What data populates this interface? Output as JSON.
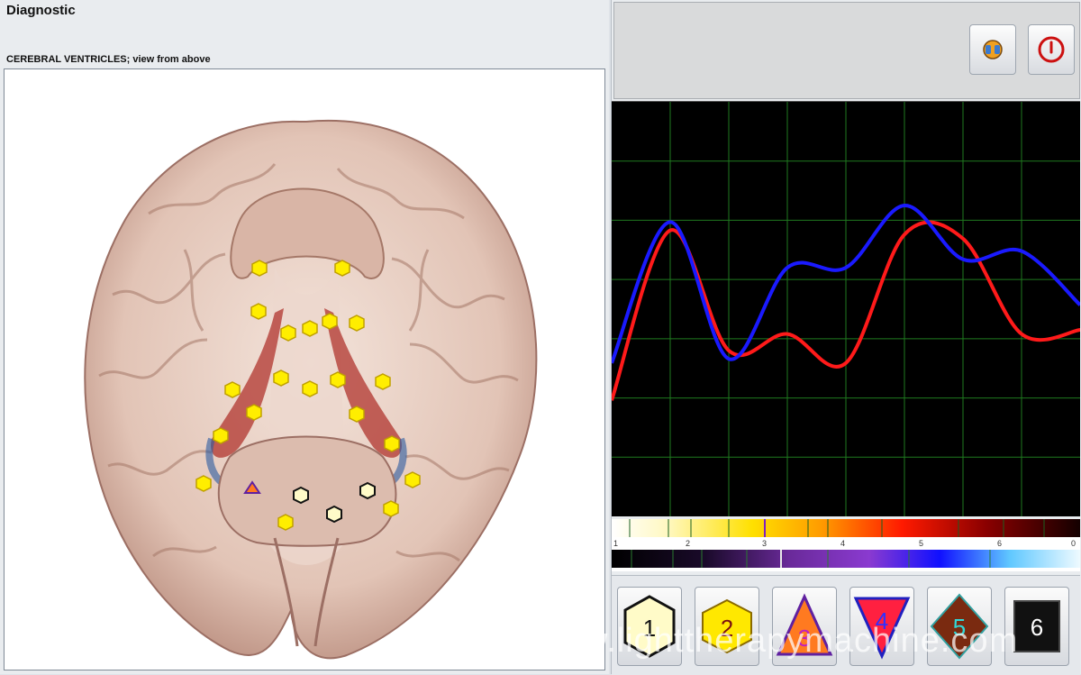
{
  "window": {
    "title": "Diagnostic"
  },
  "view": {
    "subtitle": "CEREBRAL VENTRICLES; view from above"
  },
  "controls": {
    "audio_icon": "speaker-icon",
    "power_icon": "power-icon"
  },
  "graph": {
    "series": [
      {
        "color": "#ff1a1a",
        "values": [
          0.72,
          0.31,
          0.6,
          0.56,
          0.63,
          0.32,
          0.33,
          0.56,
          0.55
        ]
      },
      {
        "color": "#1a1aff",
        "values": [
          0.63,
          0.29,
          0.62,
          0.4,
          0.4,
          0.25,
          0.38,
          0.36,
          0.49
        ]
      }
    ]
  },
  "scale": {
    "ticks": [
      "1",
      "2",
      "3",
      "4",
      "5",
      "6",
      "0"
    ]
  },
  "legend": {
    "items": [
      {
        "num": "1",
        "shape": "hexagon",
        "fill": "#fffbc8",
        "text_color": "#111"
      },
      {
        "num": "2",
        "shape": "hexagon",
        "fill": "#ffe800",
        "text_color": "#8a1010"
      },
      {
        "num": "3",
        "shape": "triangle-up",
        "fill": "#ff7a20",
        "text_color": "#c020c0"
      },
      {
        "num": "4",
        "shape": "triangle-down",
        "fill": "#ff2040",
        "text_color": "#3030ff"
      },
      {
        "num": "5",
        "shape": "diamond",
        "fill": "#7a2a10",
        "text_color": "#30d8d8"
      },
      {
        "num": "6",
        "shape": "square",
        "fill": "#111111",
        "text_color": "#ffffff"
      }
    ]
  },
  "watermark": "www.lighttherapymachine.com"
}
